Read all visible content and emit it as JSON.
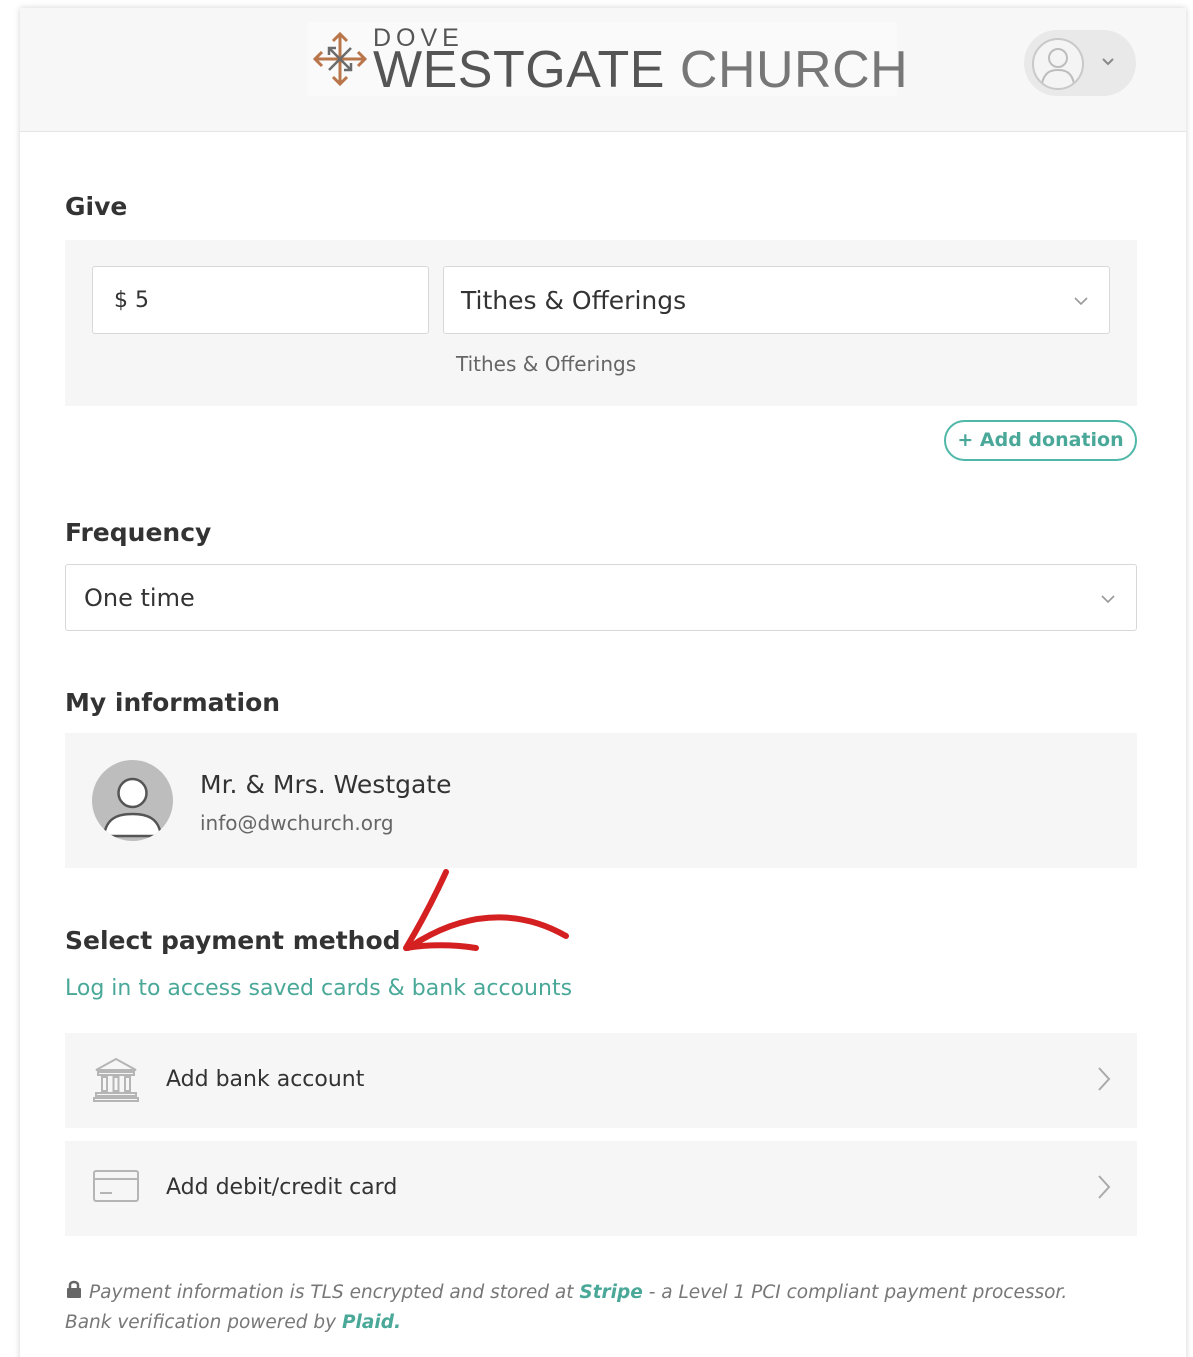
{
  "header": {
    "logo": {
      "top_text": "DOVE",
      "main_text_1": "WESTGATE",
      "main_text_2": "CHURCH"
    },
    "user_menu_icon": "user-icon"
  },
  "give": {
    "title": "Give",
    "amount": "$ 5",
    "fund": "Tithes & Offerings",
    "fund_description": "Tithes & Offerings",
    "add_donation": "+ Add donation"
  },
  "frequency": {
    "title": "Frequency",
    "value": "One time"
  },
  "my_information": {
    "title": "My information",
    "name": "Mr. & Mrs. Westgate",
    "email": "info@dwchurch.org"
  },
  "payment": {
    "title": "Select payment method",
    "login_link": "Log in to access saved cards & bank accounts",
    "options": [
      {
        "label": "Add bank account",
        "icon": "bank-icon"
      },
      {
        "label": "Add debit/credit card",
        "icon": "credit-card-icon"
      }
    ]
  },
  "security_note": {
    "part1": "Payment information is TLS encrypted and stored at ",
    "stripe": "Stripe",
    "part2": " - a Level 1 PCI compliant payment processor. Bank verification powered by ",
    "plaid": "Plaid",
    "part3": "."
  },
  "colors": {
    "accent": "#4aa899",
    "annotation_arrow": "#d42020"
  }
}
